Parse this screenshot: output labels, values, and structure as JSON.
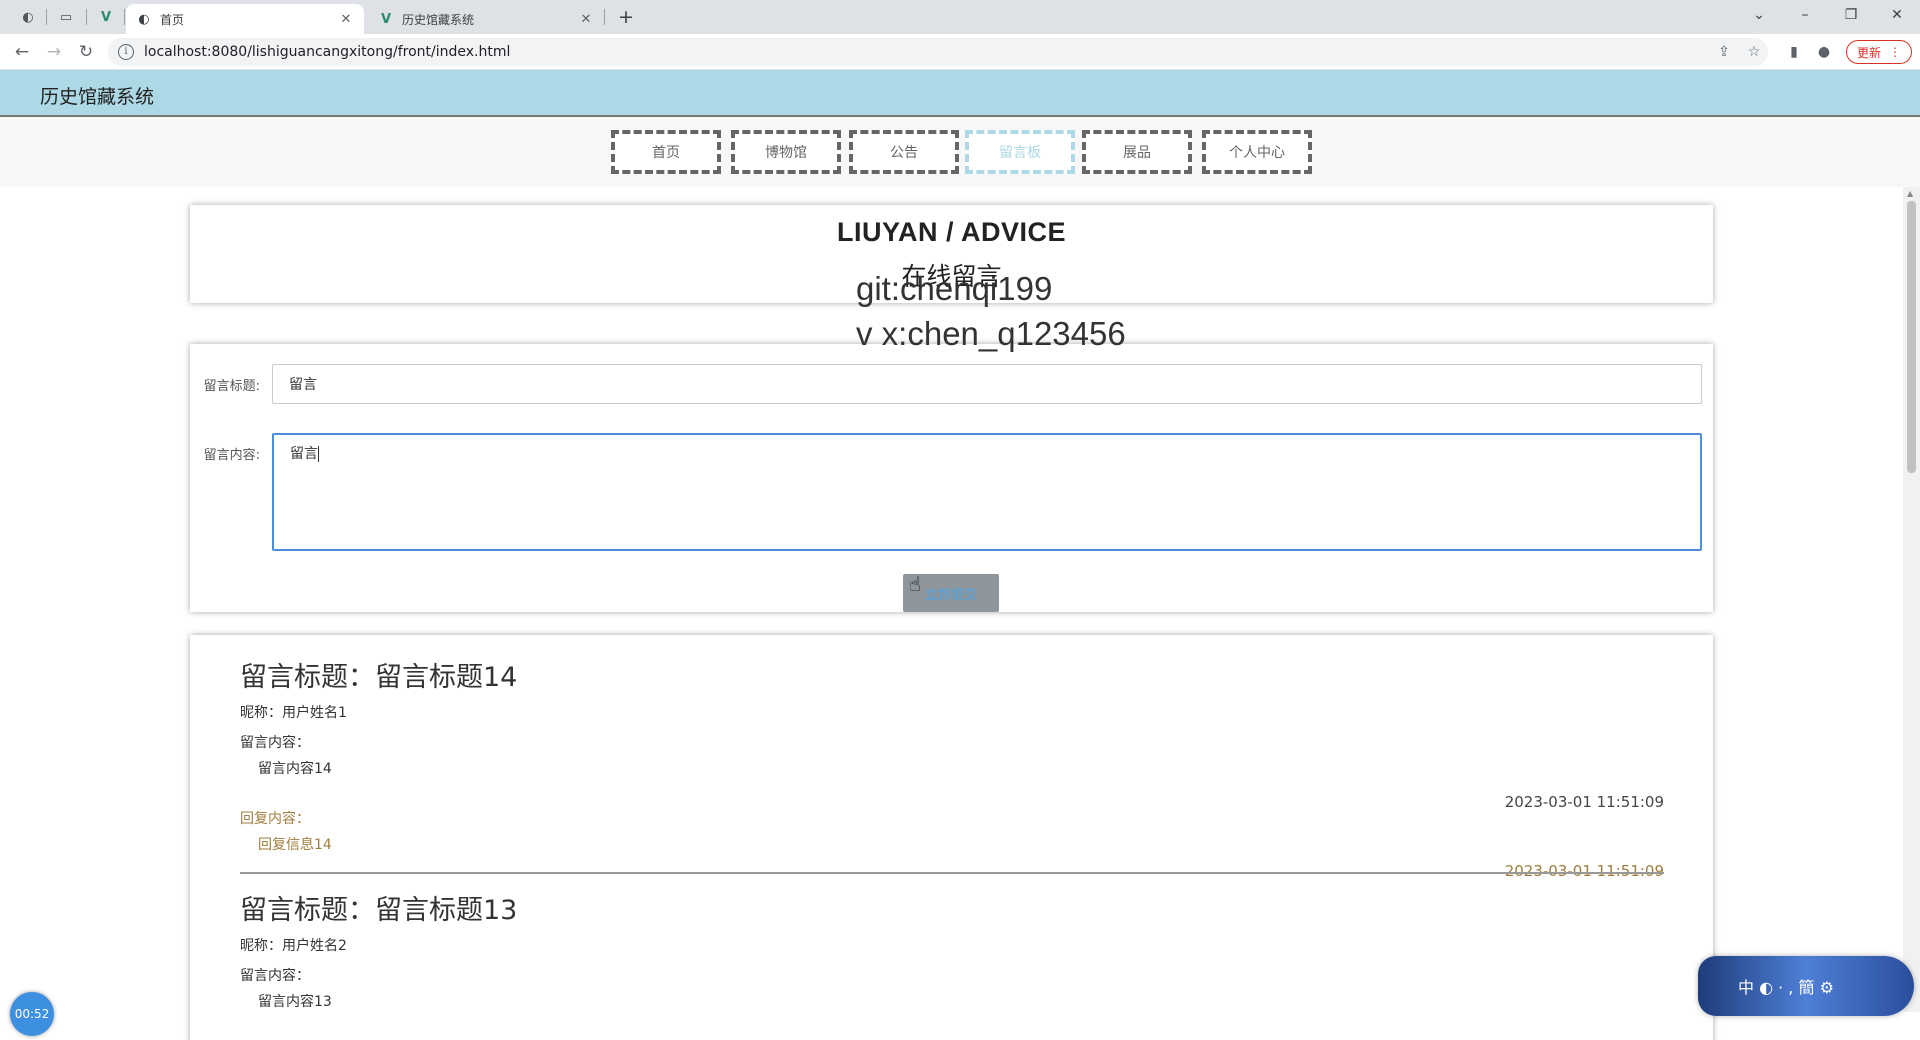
{
  "browser": {
    "tabs": [
      {
        "title": "首页",
        "favicon": "globe-icon",
        "active": true
      },
      {
        "title": "历史馆藏系统",
        "favicon": "vue-logo-icon",
        "active": false
      }
    ],
    "new_tab": "+",
    "url": "localhost:8080/lishiguancangxitong/front/index.html",
    "update_label": "更新",
    "controls": {
      "minimize": "–",
      "maximize": "❐",
      "close": "✕",
      "tab_search": "⌄"
    }
  },
  "site": {
    "title": "历史馆藏系统",
    "nav": [
      {
        "label": "首页",
        "active": false
      },
      {
        "label": "博物馆",
        "active": false
      },
      {
        "label": "公告",
        "active": false
      },
      {
        "label": "留言板",
        "active": true
      },
      {
        "label": "展品",
        "active": false
      },
      {
        "label": "个人中心",
        "active": false
      }
    ],
    "accent_color": "#add8e6"
  },
  "section": {
    "title_en": "LIUYAN / ADVICE",
    "title_cn": "在线留言"
  },
  "watermark": {
    "line1": "git:chenqi199",
    "line2": "v x:chen_q123456"
  },
  "form": {
    "title_label": "留言标题:",
    "title_value": "留言",
    "content_label": "留言内容:",
    "content_value": "留言",
    "submit_label": "立即提交"
  },
  "messages": [
    {
      "title": "留言标题：留言标题14",
      "nickname": "昵称：用户姓名1",
      "content_label": "留言内容：",
      "content": "留言内容14",
      "time": "2023-03-01 11:51:09",
      "reply_label": "回复内容：",
      "reply": "回复信息14",
      "reply_time": "2023-03-01 11:51:09"
    },
    {
      "title": "留言标题：留言标题13",
      "nickname": "昵称：用户姓名2",
      "content_label": "留言内容：",
      "content": "留言内容13"
    }
  ],
  "overlay": {
    "timer": "00:52",
    "widget_text": "中 ◐ · , 簡 ⚙"
  }
}
